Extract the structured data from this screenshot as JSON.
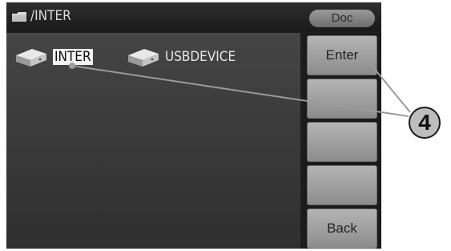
{
  "header": {
    "path": "/INTER",
    "mode": "Doc"
  },
  "files": [
    {
      "name": "INTER",
      "selected": true
    },
    {
      "name": "USBDEVICE",
      "selected": false
    }
  ],
  "softkeys": [
    "Enter",
    "",
    "",
    "",
    "Back"
  ],
  "callout": {
    "number": "4"
  },
  "icons": {
    "folder": "folder-icon",
    "drive": "disk-drive-icon"
  }
}
